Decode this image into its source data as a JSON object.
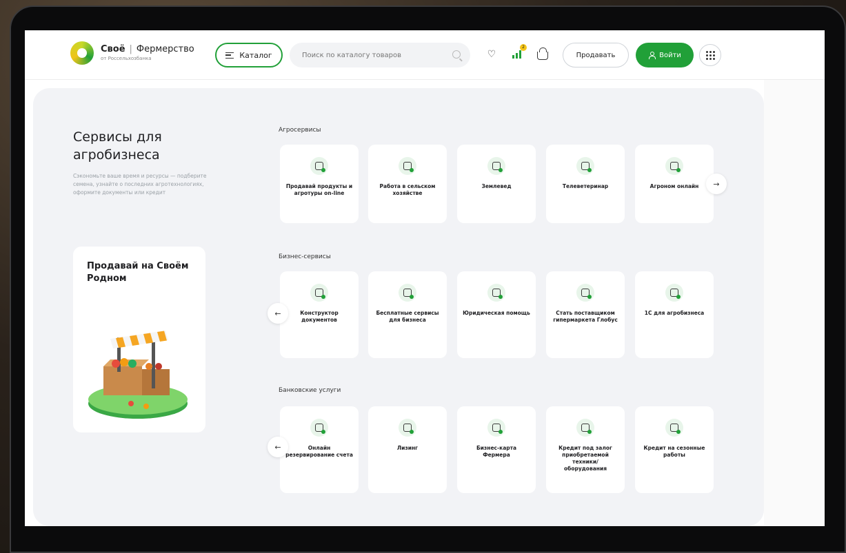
{
  "header": {
    "logo_brand": "Своё",
    "logo_product": "Фермерство",
    "logo_sub": "от Россельхозбанка",
    "catalog_label": "Каталог",
    "search_placeholder": "Поиск по каталогу товаров",
    "compare_badge": "2",
    "sell_label": "Продавать",
    "login_label": "Войти"
  },
  "intro": {
    "title": "Сервисы для агробизнеса",
    "text": "Сэкономьте ваше время и ресурсы — подберите семена, узнайте о последних агротехнологиях, оформите документы или кредит"
  },
  "promo": {
    "title": "Продавай на Своём Родном"
  },
  "sections": [
    {
      "title": "Агросервисы",
      "cards": [
        {
          "label": "Продавай продукты и агротуры on-line",
          "icon": "monitor-icon"
        },
        {
          "label": "Работа в сельском хозяйстве",
          "icon": "people-icon"
        },
        {
          "label": "Землевед",
          "icon": "microscope-icon"
        },
        {
          "label": "Телеветеринар",
          "icon": "vet-icon"
        },
        {
          "label": "Агроном онлайн",
          "icon": "agronomist-icon"
        }
      ]
    },
    {
      "title": "Бизнес-сервисы",
      "cards": [
        {
          "label": "Конструктор документов",
          "icon": "document-builder-icon"
        },
        {
          "label": "Бесплатные сервисы для бизнеса",
          "icon": "services-icon"
        },
        {
          "label": "Юридическая помощь",
          "icon": "legal-icon"
        },
        {
          "label": "Стать поставщиком гипермаркета Глобус",
          "icon": "truck-icon"
        },
        {
          "label": "1С для агробизнеса",
          "icon": "calculator-icon"
        }
      ]
    },
    {
      "title": "Банковские услуги",
      "cards": [
        {
          "label": "Онлайн резервирование счета",
          "icon": "account-icon"
        },
        {
          "label": "Лизинг",
          "icon": "leasing-icon"
        },
        {
          "label": "Бизнес-карта Фермера",
          "icon": "card-icon"
        },
        {
          "label": "Кредит под залог приобретаемой техники/ оборудования",
          "icon": "loan-equipment-icon"
        },
        {
          "label": "Кредит на сезонные работы",
          "icon": "seasonal-loan-icon"
        }
      ]
    }
  ],
  "colors": {
    "accent": "#21a038",
    "panel": "#f2f3f6",
    "badge": "#f5c518"
  }
}
